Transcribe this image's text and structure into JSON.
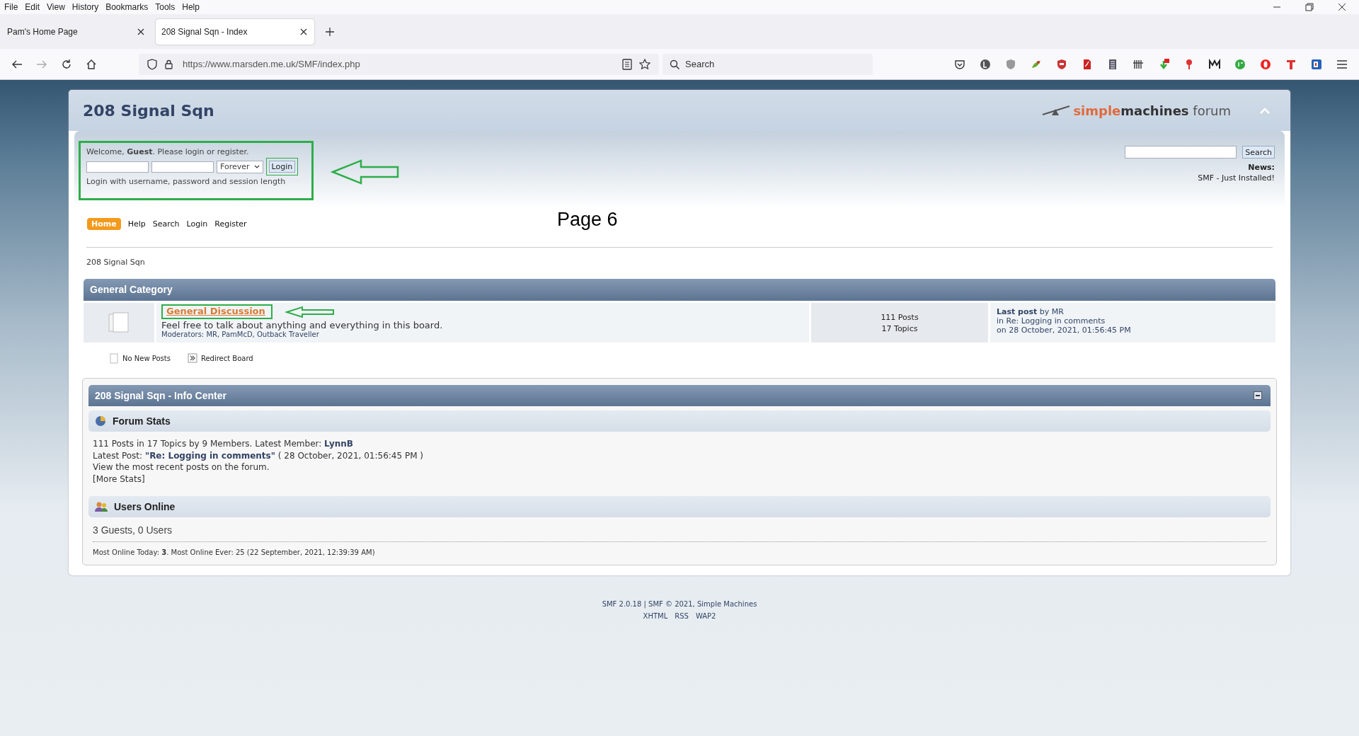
{
  "browser": {
    "menu": [
      "File",
      "Edit",
      "View",
      "History",
      "Bookmarks",
      "Tools",
      "Help"
    ],
    "tabs": [
      {
        "label": "Pam's Home Page",
        "selected": false
      },
      {
        "label": "208 Signal Sqn - Index",
        "selected": true
      }
    ],
    "url": "https://www.marsden.me.uk/SMF/index.php",
    "search_placeholder": "Search"
  },
  "forum": {
    "title": "208 Signal Sqn",
    "logo": {
      "part_1": "simple",
      "part_2": "machines",
      "part_3": "forum"
    },
    "login": {
      "welcome": "Welcome, **Guest**. Please login or register.",
      "session": "Forever",
      "button": "Login",
      "hint": "Login with username, password and session length"
    },
    "search": {
      "button": "Search"
    },
    "news": {
      "label": "News:",
      "text": "SMF - Just Installed!"
    },
    "annotation": "Page 6",
    "nav": [
      {
        "label": "Home",
        "selected": true
      },
      {
        "label": "Help",
        "selected": false
      },
      {
        "label": "Search",
        "selected": false
      },
      {
        "label": "Login",
        "selected": false
      },
      {
        "label": "Register",
        "selected": false
      }
    ],
    "breadcrumb": "208 Signal Sqn",
    "category": {
      "title": "General Category",
      "boards": [
        {
          "name": "General Discussion",
          "description": "Feel free to talk about anything and everything in this board.",
          "moderators": "Moderators: MR, PamMcD, Outback Traveller",
          "posts": "111 Posts",
          "topics": "17 Topics",
          "last_post": "**Last post** by MR",
          "last_topic": "in Re: Logging in comments",
          "last_date": "on 28 October, 2021, 01:56:45 PM"
        }
      ]
    },
    "legend": [
      {
        "kind": "no-new",
        "label": "No New Posts"
      },
      {
        "kind": "redirect",
        "label": "Redirect Board"
      }
    ],
    "info_center": {
      "title": "208 Signal Sqn - Info Center",
      "sections": [
        {
          "kind": "stats",
          "title": "Forum Stats",
          "lines": [
            "111 Posts in 17 Topics by 9 Members. Latest Member: **LynnB**",
            "Latest Post: **\"Re: Logging in comments\"** ( 28 October, 2021, 01:56:45 PM )",
            "View the most recent posts on the forum.",
            "[More Stats]"
          ]
        },
        {
          "kind": "users",
          "title": "Users Online",
          "summary": "3 Guests, 0 Users",
          "record": "Most Online Today: **3**. Most Online Ever: 25 (22 September, 2021, 12:39:39 AM)"
        }
      ]
    }
  },
  "footer": {
    "credit": "SMF 2.0.18 | SMF © 2021, Simple Machines",
    "links": [
      "XHTML",
      "RSS",
      "WAP2"
    ]
  }
}
